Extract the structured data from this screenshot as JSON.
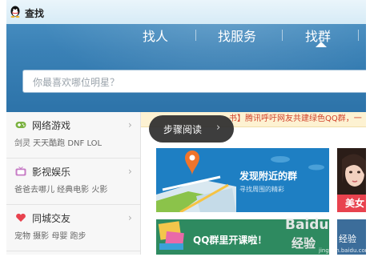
{
  "window": {
    "title": "查找"
  },
  "nav": {
    "tabs": [
      {
        "label": "找人"
      },
      {
        "label": "找服务"
      },
      {
        "label": "找群"
      }
    ],
    "active_index": 2
  },
  "search": {
    "placeholder": "你最喜欢哪位明星？"
  },
  "sidebar": {
    "items": [
      {
        "title": "网络游戏",
        "sub": "剑灵  天天酷跑  DNF  LOL",
        "icon": "gamepad-icon"
      },
      {
        "title": "影视娱乐",
        "sub": "爸爸去哪儿  经典电影  火影",
        "icon": "tv-icon"
      },
      {
        "title": "同城交友",
        "sub": "宠物  摄影  母婴  跑步",
        "icon": "heart-icon"
      }
    ]
  },
  "main": {
    "ticker": "书】腾讯呼吁网友共建绿色QQ群，一",
    "banner1": {
      "title": "发现附近的群",
      "subtitle": "寻找周围的精彩"
    },
    "portrait": {
      "caption": "美女"
    },
    "banner2": {
      "title": "QQ群里开课啦！"
    },
    "banner3": {
      "text": "经验"
    }
  },
  "tooltip": {
    "label": "步骤阅读",
    "arrow": "›"
  },
  "watermark": {
    "brand": "Baidu",
    "sub": "jingyan.baidu.com"
  },
  "colors": {
    "header_blue": "#3a81b6",
    "ticker_red": "#d0402a",
    "accent_red": "#e8424e"
  }
}
